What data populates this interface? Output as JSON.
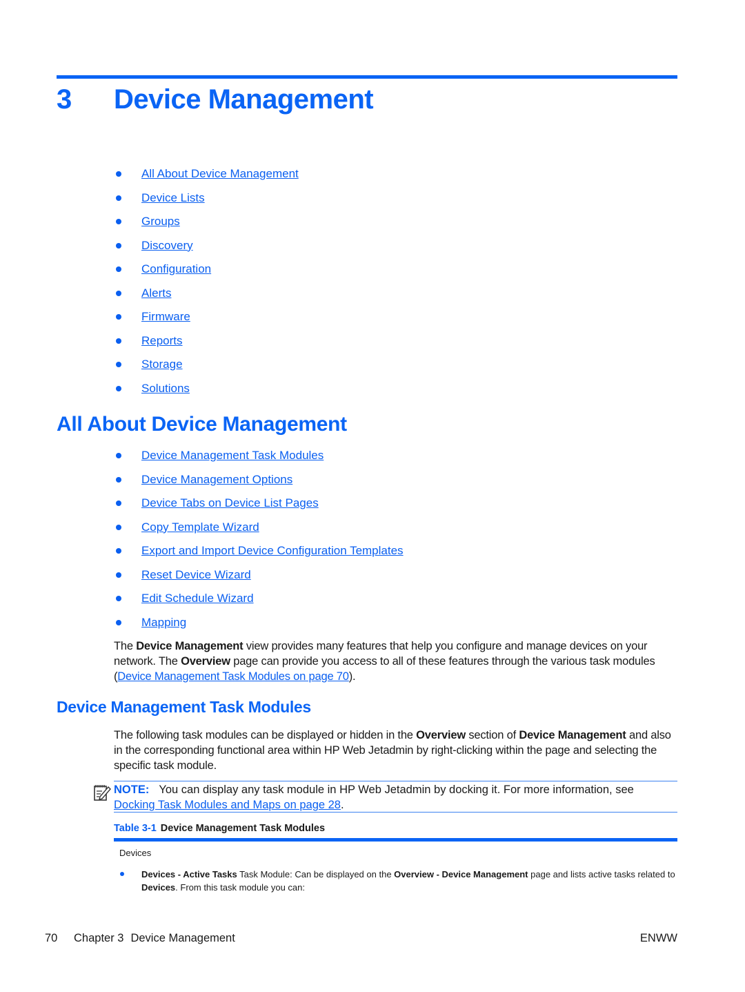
{
  "chapter": {
    "number": "3",
    "title": "Device Management"
  },
  "toc": [
    {
      "label": "All About Device Management"
    },
    {
      "label": "Device Lists"
    },
    {
      "label": "Groups"
    },
    {
      "label": "Discovery"
    },
    {
      "label": "Configuration"
    },
    {
      "label": "Alerts"
    },
    {
      "label": "Firmware"
    },
    {
      "label": "Reports"
    },
    {
      "label": "Storage"
    },
    {
      "label": "Solutions"
    }
  ],
  "section1": {
    "heading": "All About Device Management",
    "links": [
      {
        "label": "Device Management Task Modules"
      },
      {
        "label": "Device Management Options"
      },
      {
        "label": "Device Tabs on Device List Pages"
      },
      {
        "label": "Copy Template Wizard"
      },
      {
        "label": "Export and Import Device Configuration Templates"
      },
      {
        "label": "Reset Device Wizard"
      },
      {
        "label": "Edit Schedule Wizard"
      },
      {
        "label": "Mapping"
      }
    ],
    "paragraph": {
      "t1": "The ",
      "b1": "Device Management",
      "t2": " view provides many features that help you configure and manage devices on your network. The ",
      "b2": "Overview",
      "t3": " page can provide you access to all of these features through the various task modules (",
      "link": "Device Management Task Modules on page 70",
      "t4": ")."
    }
  },
  "section2": {
    "heading": "Device Management Task Modules",
    "paragraph": {
      "t1": "The following task modules can be displayed or hidden in the ",
      "b1": "Overview",
      "t2": " section of ",
      "b2": "Device Management",
      "t3": " and also in the corresponding functional area within HP Web Jetadmin by right-clicking within the page and selecting the specific task module."
    },
    "note": {
      "label": "NOTE:",
      "text": "You can display any task module in HP Web Jetadmin by docking it. For more information, see ",
      "link": "Docking Task Modules and Maps on page 28",
      "end": "."
    },
    "table": {
      "number": "Table 3-1",
      "title": "Device Management Task Modules",
      "header": "Devices",
      "item": {
        "b1": "Devices - Active Tasks",
        "t1": " Task Module: Can be displayed on the ",
        "b2": "Overview - Device Management",
        "t2": " page and lists active tasks related to ",
        "b3": "Devices",
        "t3": ". From this task module you can:"
      }
    }
  },
  "footer": {
    "page": "70",
    "chapter": "Chapter 3",
    "title": "Device Management",
    "right": "ENWW"
  },
  "colors": {
    "accent": "#0a64f5",
    "link": "#0a5ff0"
  }
}
